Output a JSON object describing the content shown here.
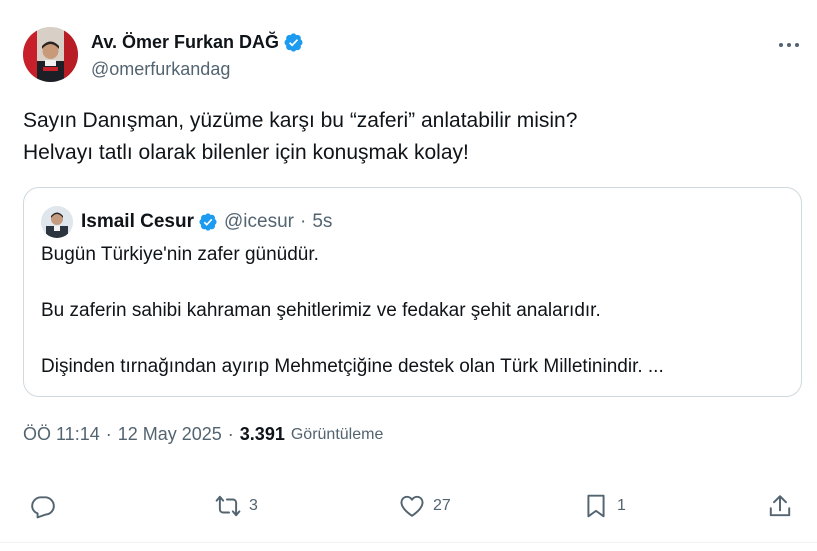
{
  "author": {
    "display_name": "Av. Ömer Furkan DAĞ",
    "handle": "@omerfurkandag"
  },
  "tweet": {
    "lines": [
      "Sayın Danışman, yüzüme karşı bu “zaferi” anlatabilir misin?",
      "Helvayı tatlı olarak bilenler için konuşmak kolay!"
    ]
  },
  "quote": {
    "display_name": "Ismail Cesur",
    "handle": "@icesur",
    "separator": "·",
    "time": "5s",
    "lines": [
      "Bugün Türkiye'nin zafer günüdür.",
      "Bu zaferin sahibi kahraman şehitlerimiz ve fedakar şehit analarıdır.",
      "Dişinden tırnağından ayırıp Mehmetçiğine destek olan Türk Milletinindir. ..."
    ]
  },
  "meta": {
    "time": "ÖÖ 11:14",
    "separator": "·",
    "date": "12 May 2025",
    "views_count": "3.391",
    "views_label": "Görüntüleme"
  },
  "actions": {
    "replies": "",
    "reposts": "3",
    "likes": "27",
    "bookmarks": "1"
  },
  "colors": {
    "text": "#0f1419",
    "secondary": "#536471",
    "verified": "#1d9bf0",
    "border": "#cfd9de"
  },
  "icons": [
    "verified-badge-icon",
    "more-icon",
    "reply-icon",
    "repost-icon",
    "like-icon",
    "bookmark-icon",
    "share-icon"
  ]
}
